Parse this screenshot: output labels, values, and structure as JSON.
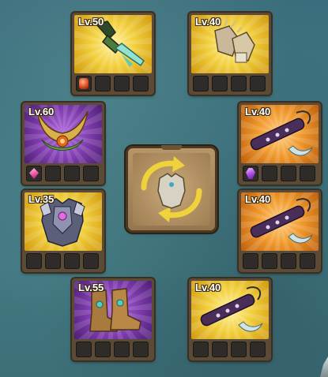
{
  "center_slot": {
    "icon": "swap-armor-icon"
  },
  "slots": [
    {
      "id": "weapon",
      "level": "Lv.50",
      "rarity": "gold",
      "icon": "gauntlet-blade-icon",
      "gems": [
        "red",
        "",
        "",
        ""
      ]
    },
    {
      "id": "gloves",
      "level": "Lv.40",
      "rarity": "gold",
      "icon": "golden-gauntlets-icon",
      "gems": [
        "",
        "",
        "",
        ""
      ]
    },
    {
      "id": "helmet",
      "level": "Lv.60",
      "rarity": "purple",
      "icon": "horned-crown-icon",
      "gems": [
        "pink",
        "",
        "",
        ""
      ]
    },
    {
      "id": "accessory1",
      "level": "Lv.40",
      "rarity": "orange",
      "icon": "horn-flute-icon",
      "gems": [
        "violet",
        "",
        "",
        ""
      ]
    },
    {
      "id": "armor",
      "level": "Lv.35",
      "rarity": "gold",
      "icon": "plate-armor-icon",
      "gems": [
        "",
        "",
        "",
        ""
      ]
    },
    {
      "id": "accessory2",
      "level": "Lv.40",
      "rarity": "orange",
      "icon": "horn-flute-icon",
      "gems": [
        "",
        "",
        "",
        ""
      ]
    },
    {
      "id": "boots",
      "level": "Lv.55",
      "rarity": "purple",
      "icon": "leather-boots-icon",
      "gems": [
        "",
        "",
        "",
        ""
      ]
    },
    {
      "id": "accessory3",
      "level": "Lv.40",
      "rarity": "gold",
      "icon": "horn-flute-icon",
      "gems": [
        "",
        "",
        "",
        ""
      ]
    }
  ]
}
